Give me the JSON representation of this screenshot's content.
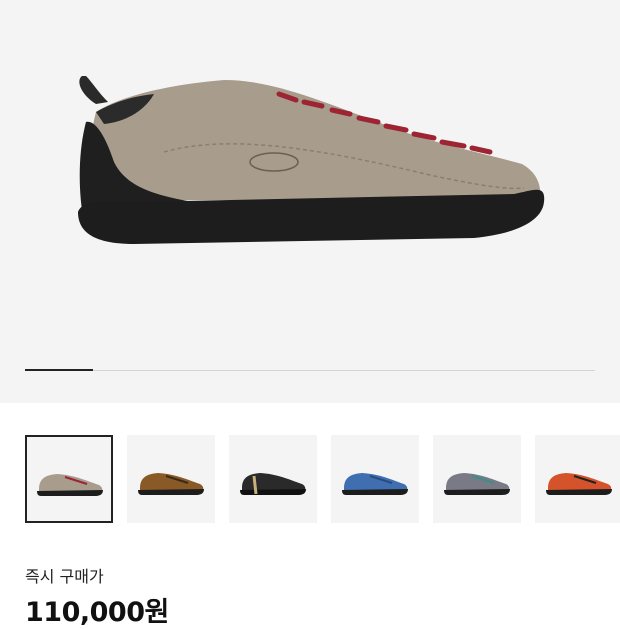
{
  "hero": {
    "image_icon": "shoe-image-taupe",
    "slider_progress": 0.12,
    "colors": {
      "upper": "#a89c8c",
      "sole": "#1d1d1d",
      "laces": "#9c2433"
    }
  },
  "thumbnails": [
    {
      "icon": "shoe-thumb-taupe",
      "upper": "#a89c8c",
      "laces": "#9c2433",
      "selected": true
    },
    {
      "icon": "shoe-thumb-brown",
      "upper": "#8a5a26",
      "laces": "#3a2a1a",
      "selected": false
    },
    {
      "icon": "shoe-thumb-black",
      "upper": "#2a2a2a",
      "laces": "#1a1a1a",
      "selected": false
    },
    {
      "icon": "shoe-thumb-blue",
      "upper": "#3f6fb0",
      "laces": "#2a4a80",
      "selected": false
    },
    {
      "icon": "shoe-thumb-gray",
      "upper": "#7a7a86",
      "laces": "#3a8f8a",
      "selected": false
    },
    {
      "icon": "shoe-thumb-orange",
      "upper": "#d4532a",
      "laces": "#222222",
      "selected": false
    }
  ],
  "price": {
    "label": "즉시 구매가",
    "value": "110,000원"
  }
}
